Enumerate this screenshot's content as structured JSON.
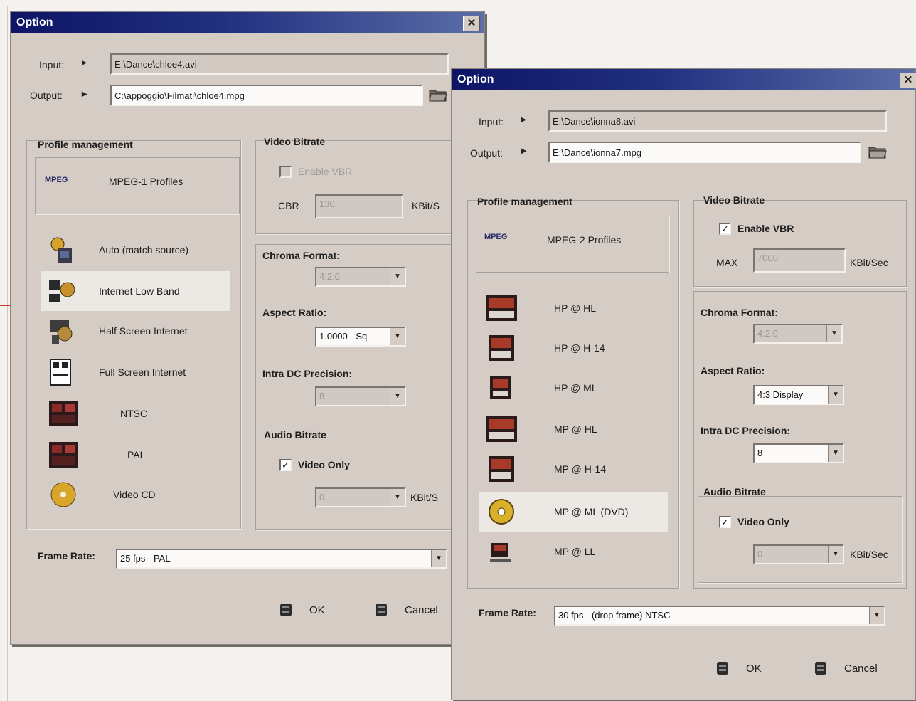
{
  "dialog1": {
    "title": "Option",
    "close": "✕",
    "input_label": "Input:",
    "input_value": "E:\\Dance\\chloe4.avi",
    "output_label": "Output:",
    "output_value": "C:\\appoggio\\Filmati\\chloe4.mpg",
    "profile_group": "Profile management",
    "profile_set_label": "MPEG-1 Profiles",
    "profiles": [
      "Auto (match source)",
      "Internet Low Band",
      "Half Screen Internet",
      "Full Screen Internet",
      "NTSC",
      "PAL",
      "Video CD"
    ],
    "selected_profile": "Internet Low Band",
    "video_bitrate_group": "Video Bitrate",
    "enable_vbr_label": "Enable VBR",
    "enable_vbr_checked": false,
    "cbr_label": "CBR",
    "cbr_value": "130",
    "kbs_unit": "KBit/S",
    "chroma_label": "Chroma Format:",
    "chroma_value": "4:2:0",
    "aspect_label": "Aspect Ratio:",
    "aspect_value": "1.0000 - Sq",
    "intra_label": "Intra DC Precision:",
    "intra_value": "8",
    "audio_group": "Audio Bitrate",
    "video_only_label": "Video Only",
    "video_only_checked": true,
    "audio_value": "0",
    "frame_rate_label": "Frame Rate:",
    "frame_rate_value": "25 fps - PAL",
    "ok_label": "OK",
    "cancel_label": "Cancel"
  },
  "dialog2": {
    "title": "Option",
    "close": "✕",
    "input_label": "Input:",
    "input_value": "E:\\Dance\\ionna8.avi",
    "output_label": "Output:",
    "output_value": "E:\\Dance\\ionna7.mpg",
    "profile_group": "Profile management",
    "profile_set_label": "MPEG-2 Profiles",
    "profiles": [
      "HP @ HL",
      "HP @ H-14",
      "HP @ ML",
      "MP @ HL",
      "MP @ H-14",
      "MP @ ML (DVD)",
      "MP @ LL"
    ],
    "selected_profile": "MP @ ML (DVD)",
    "video_bitrate_group": "Video Bitrate",
    "enable_vbr_label": "Enable VBR",
    "enable_vbr_checked": true,
    "max_label": "MAX",
    "max_value": "7000",
    "kbs_unit": "KBit/Sec",
    "chroma_label": "Chroma Format:",
    "chroma_value": "4:2:0",
    "aspect_label": "Aspect Ratio:",
    "aspect_value": "4:3 Display",
    "intra_label": "Intra DC Precision:",
    "intra_value": "8",
    "audio_group": "Audio Bitrate",
    "video_only_label": "Video Only",
    "video_only_checked": true,
    "audio_value": "0",
    "frame_rate_label": "Frame Rate:",
    "frame_rate_value": "30 fps - (drop frame) NTSC",
    "ok_label": "OK",
    "cancel_label": "Cancel"
  },
  "icons": {
    "mpeg_logo": "mpeg-logo-icon",
    "input_arrow": "▸",
    "checkmark": "✓",
    "dropdown": "▼"
  }
}
